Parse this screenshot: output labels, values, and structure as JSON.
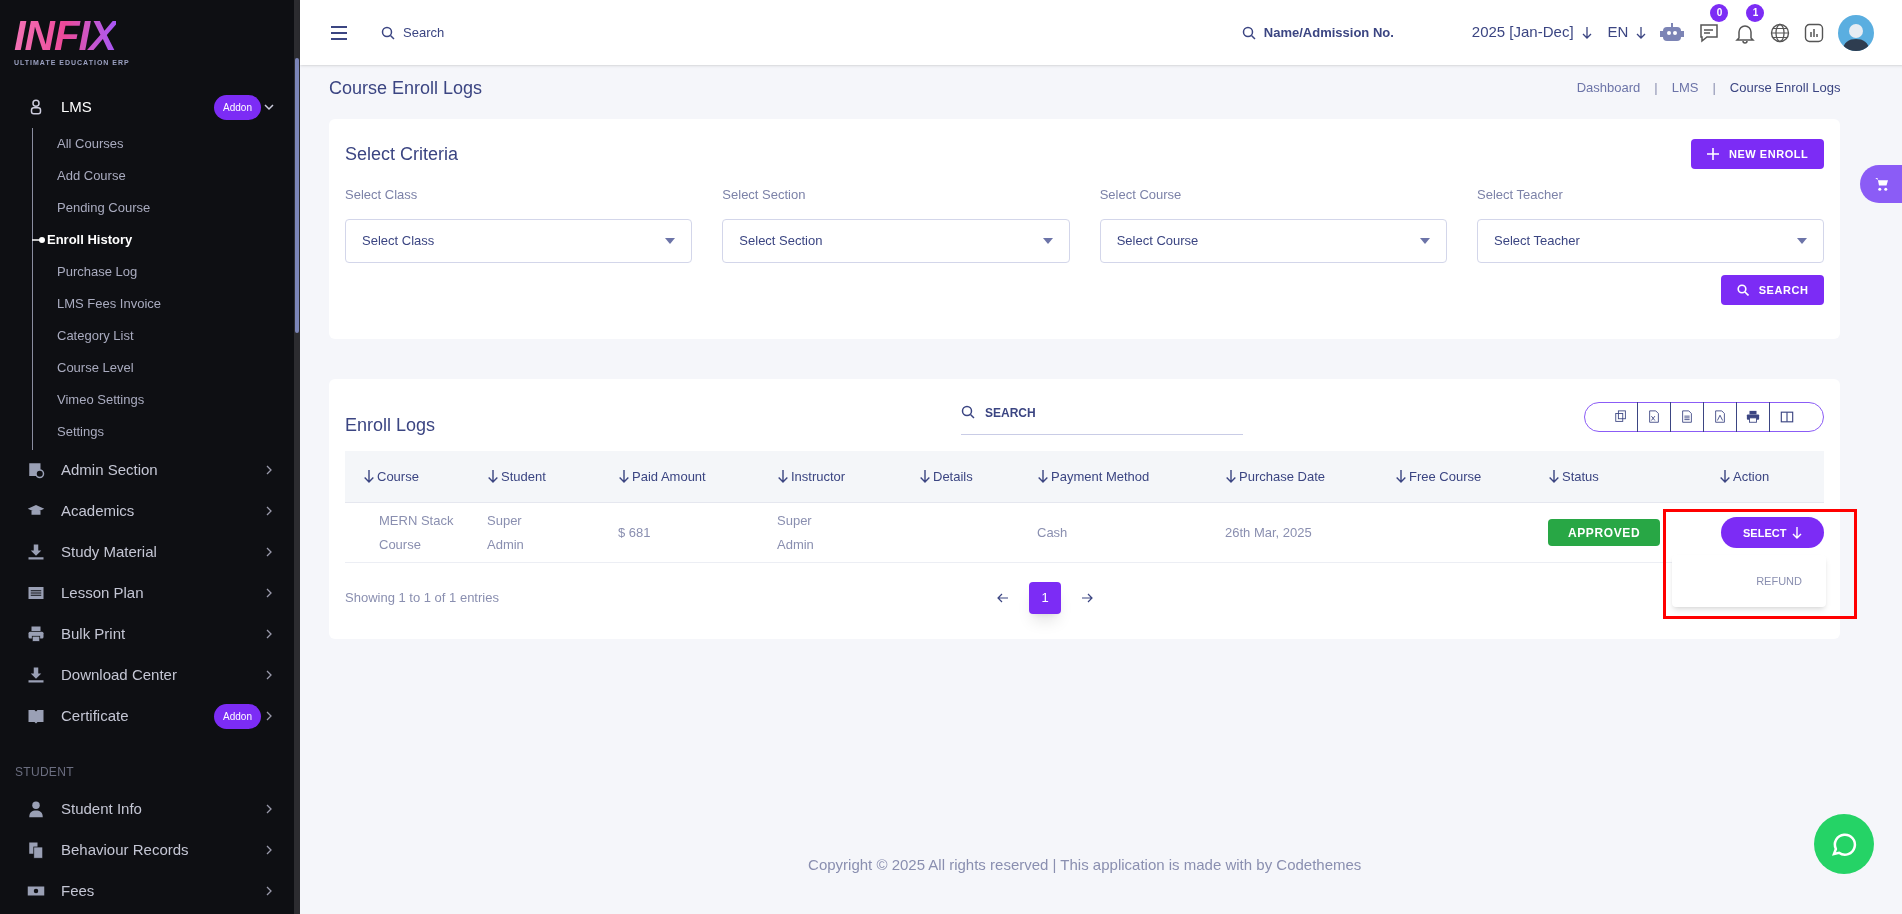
{
  "logo": {
    "name": "INFIX",
    "tagline": "ULTIMATE EDUCATION ERP"
  },
  "sidebar": {
    "items": [
      {
        "kind": "group",
        "label": "LMS",
        "badge": "Addon",
        "expanded": true,
        "children": [
          {
            "label": "All Courses",
            "selected": false
          },
          {
            "label": "Add Course",
            "selected": false
          },
          {
            "label": "Pending Course",
            "selected": false
          },
          {
            "label": "Enroll History",
            "selected": true
          },
          {
            "label": "Purchase Log",
            "selected": false
          },
          {
            "label": "LMS Fees Invoice",
            "selected": false
          },
          {
            "label": "Category List",
            "selected": false
          },
          {
            "label": "Course Level",
            "selected": false
          },
          {
            "label": "Vimeo Settings",
            "selected": false
          },
          {
            "label": "Settings",
            "selected": false
          }
        ]
      },
      {
        "kind": "group",
        "label": "Admin Section",
        "expanded": false
      },
      {
        "kind": "group",
        "label": "Academics",
        "expanded": false
      },
      {
        "kind": "group",
        "label": "Study Material",
        "expanded": false
      },
      {
        "kind": "group",
        "label": "Lesson Plan",
        "expanded": false
      },
      {
        "kind": "group",
        "label": "Bulk Print",
        "expanded": false
      },
      {
        "kind": "group",
        "label": "Download Center",
        "expanded": false
      },
      {
        "kind": "group",
        "label": "Certificate",
        "badge": "Addon",
        "expanded": false
      },
      {
        "kind": "section",
        "label": "STUDENT"
      },
      {
        "kind": "group",
        "label": "Student Info",
        "expanded": false
      },
      {
        "kind": "group",
        "label": "Behaviour Records",
        "expanded": false
      },
      {
        "kind": "group",
        "label": "Fees",
        "expanded": false
      }
    ]
  },
  "header": {
    "search": {
      "placeholder": "Search"
    },
    "student_search": {
      "placeholder": "Name/Admission No."
    },
    "session": "2025 [Jan-Dec]",
    "language": "EN",
    "message_count": "0",
    "notification_count": "1"
  },
  "page": {
    "title": "Course Enroll Logs",
    "breadcrumbs": [
      "Dashboard",
      "LMS",
      "Course Enroll Logs"
    ],
    "breadcrumb_separator": "|"
  },
  "criteria": {
    "title": "Select Criteria",
    "new_button": "NEW ENROLL",
    "fields": [
      {
        "label": "Select Class",
        "placeholder": "Select Class"
      },
      {
        "label": "Select Section",
        "placeholder": "Select Section"
      },
      {
        "label": "Select Course",
        "placeholder": "Select Course"
      },
      {
        "label": "Select Teacher",
        "placeholder": "Select Teacher"
      }
    ],
    "search_button": "SEARCH"
  },
  "table": {
    "title": "Enroll Logs",
    "search": {
      "placeholder": "SEARCH"
    },
    "columns": [
      "Course",
      "Student",
      "Paid Amount",
      "Instructor",
      "Details",
      "Payment Method",
      "Purchase Date",
      "Free Course",
      "Status",
      "Action"
    ],
    "rows": [
      {
        "course": [
          "MERN Stack",
          "Course"
        ],
        "student": [
          "Super",
          "Admin"
        ],
        "paid": "$ 681",
        "instructor": [
          "Super",
          "Admin"
        ],
        "payment": "Cash",
        "date": "26th Mar, 2025",
        "status": "APPROVED",
        "action": {
          "label": "SELECT",
          "expanded": true,
          "options": [
            "REFUND"
          ]
        }
      }
    ],
    "info": "Showing 1 to 1 of 1 entries",
    "pages": [
      {
        "label": "1",
        "selected": true
      }
    ]
  },
  "footer": "Copyright © 2025 All rights reserved | This application is made with by Codethemes"
}
